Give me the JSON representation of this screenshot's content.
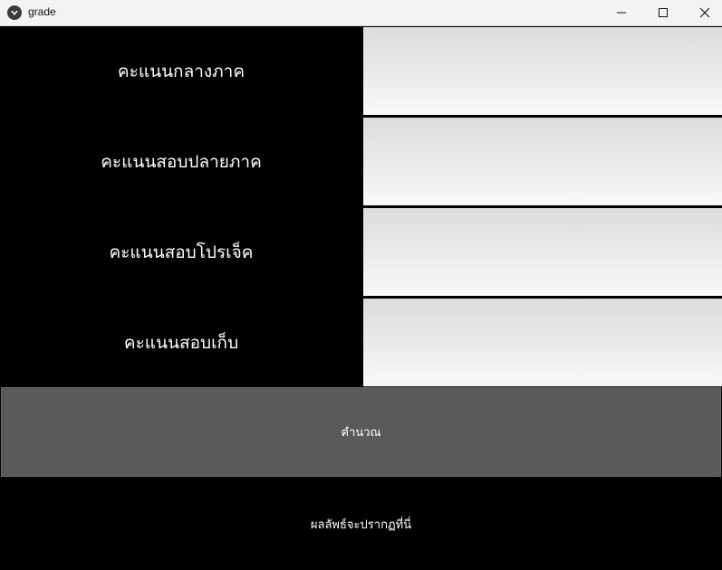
{
  "window": {
    "title": "grade",
    "icon": "app-icon",
    "controls": [
      "minimize-icon",
      "maximize-icon",
      "close-icon"
    ]
  },
  "form": {
    "fields": [
      {
        "label": "คะแนนกลางภาค",
        "value": ""
      },
      {
        "label": "คะแนนสอบปลายภาค",
        "value": ""
      },
      {
        "label": "คะแนนสอบโปรเจ็ค",
        "value": ""
      },
      {
        "label": "คะแนนสอบเก็บ",
        "value": ""
      }
    ],
    "calculate_label": "คำนวณ",
    "result_text": "ผลลัพธ์จะปรากฏที่นี่"
  },
  "colors": {
    "background": "#000000",
    "button": "#5a5a5a",
    "text": "#ffffff"
  }
}
